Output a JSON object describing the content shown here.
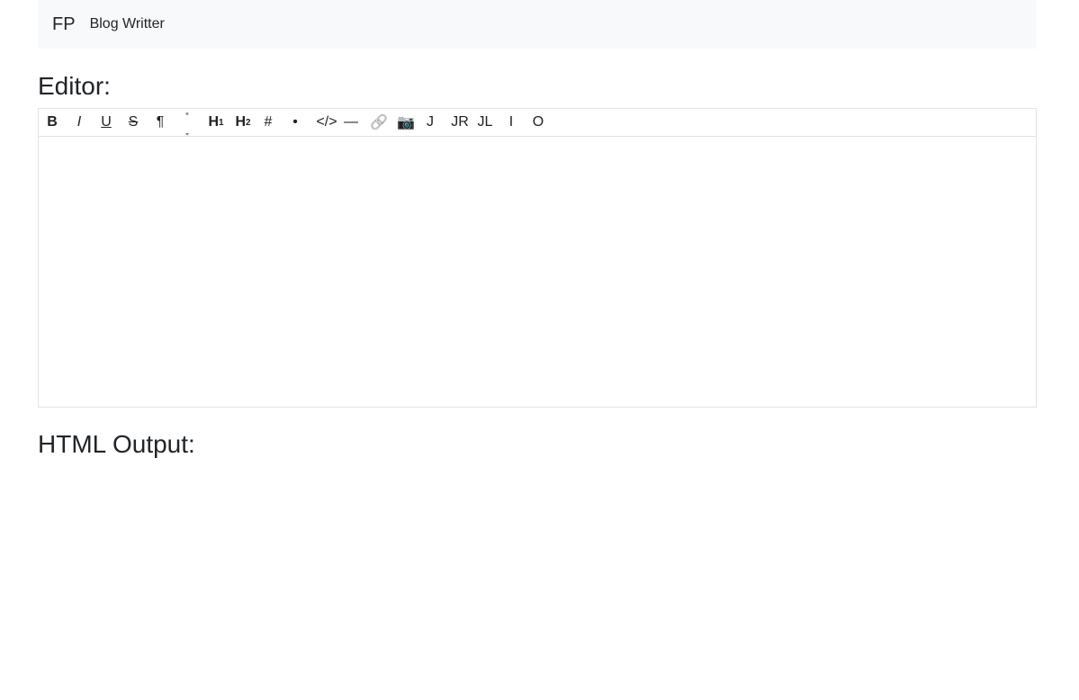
{
  "navbar": {
    "brand": "FP",
    "link": "Blog Writter"
  },
  "editor": {
    "title": "Editor:",
    "toolbar": {
      "bold": "B",
      "italic": "I",
      "underline": "U",
      "strikethrough": "S",
      "paragraph": "¶",
      "quote_open": "“",
      "quote_close": "”",
      "heading1": "H",
      "heading1_sub": "1",
      "heading2": "H",
      "heading2_sub": "2",
      "ordered_list": "#",
      "bullet_list": "•",
      "code": "</>",
      "horizontal_rule": "—",
      "link": "🔗",
      "image": "📷",
      "justify": "J",
      "justify_right": "JR",
      "justify_left": "JL",
      "indent": "I",
      "outdent": "O"
    },
    "content": ""
  },
  "output": {
    "title": "HTML Output:"
  }
}
